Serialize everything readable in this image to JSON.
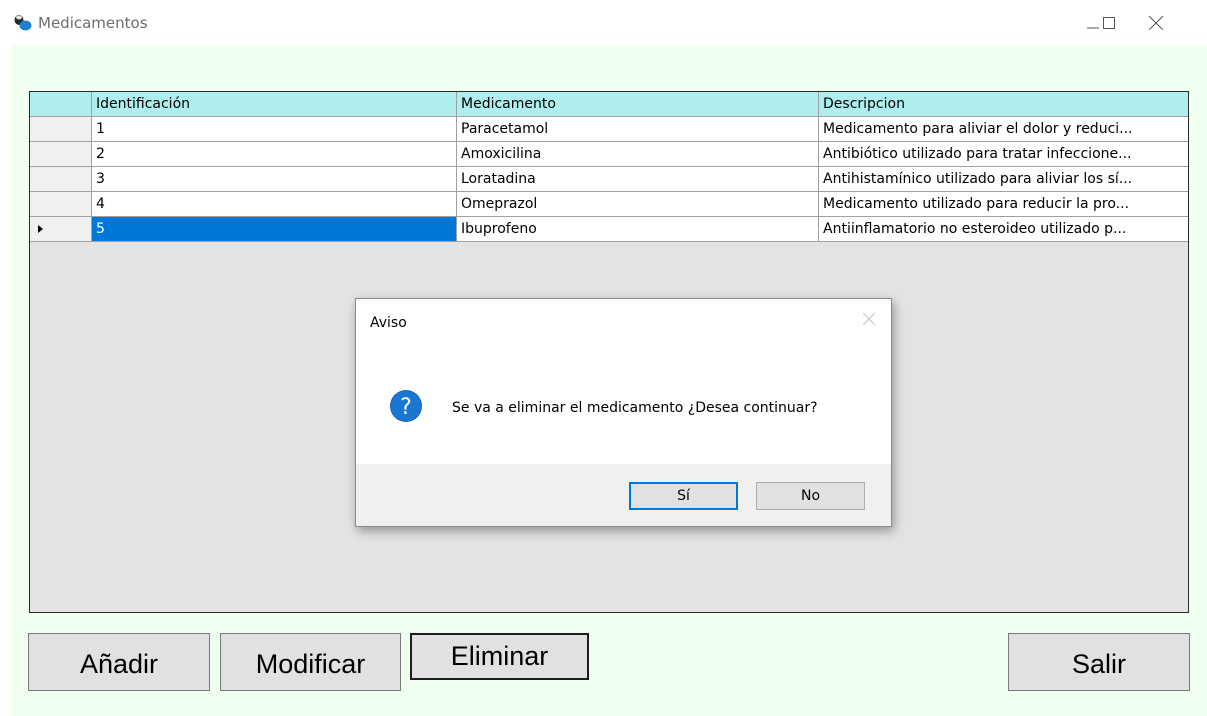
{
  "window": {
    "title": "Medicamentos",
    "app_icon": "pills-icon",
    "controls": [
      "minimize-icon",
      "maximize-icon",
      "close-icon"
    ]
  },
  "grid": {
    "columns": [
      "Identificación",
      "Medicamento",
      "Descripcion"
    ],
    "rows": [
      [
        "1",
        "Paracetamol",
        "Medicamento para aliviar el dolor y reduci..."
      ],
      [
        "2",
        "Amoxicilina",
        "Antibiótico utilizado para tratar infeccione..."
      ],
      [
        "3",
        "Loratadina",
        "Antihistamínico utilizado para aliviar los sí..."
      ],
      [
        "4",
        "Omeprazol",
        "Medicamento utilizado para reducir la pro..."
      ],
      [
        "5",
        "Ibuprofeno",
        "Antiinflamatorio no esteroideo utilizado p..."
      ]
    ],
    "selected_row": 4,
    "header_color": "#afeeee",
    "selection_color": "#0078d7"
  },
  "buttons": {
    "add": "Añadir",
    "modify": "Modificar",
    "delete": "Eliminar",
    "exit": "Salir"
  },
  "dialog": {
    "title": "Aviso",
    "icon": "question-icon",
    "message": "Se va a eliminar el medicamento ¿Desea continuar?",
    "yes": "Sí",
    "no": "No"
  },
  "colors": {
    "client_background": "#f0fff0"
  }
}
